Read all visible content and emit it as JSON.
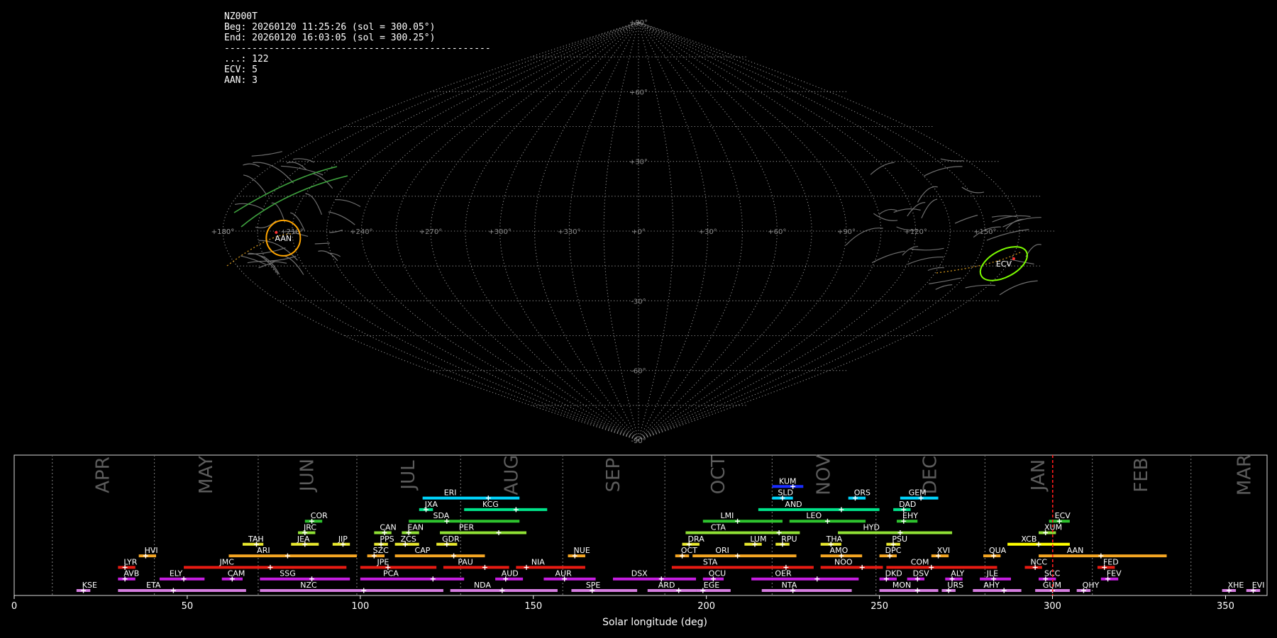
{
  "info": {
    "station": "NZ000T",
    "begin": "Beg: 20260120 11:25:26 (sol = 300.05°)",
    "end": "End: 20260120 16:03:05 (sol = 300.25°)",
    "separator": "------------------------------------------------",
    "counts": [
      "...: 122",
      "ECV: 5",
      "AAN: 3"
    ]
  },
  "sky": {
    "lon_ticks": [
      "+180°",
      "+150°",
      "+120°",
      "+90°",
      "+60°",
      "+30°",
      "+0°",
      "+330°",
      "+300°",
      "+270°",
      "+240°",
      "+210°",
      "+180°"
    ],
    "lat_ticks": [
      "+90°",
      "+60°",
      "+30°",
      "-30°",
      "-60°",
      "-90°"
    ],
    "radiants": [
      {
        "name": "AAN",
        "lon": 154,
        "lat": -3,
        "color": "#ffa500"
      },
      {
        "name": "ECV",
        "lon": 197,
        "lat": -14,
        "color": "#7cfc00"
      }
    ]
  },
  "chart_data": {
    "type": "gantt",
    "xlabel": "Solar longitude (deg)",
    "xlim": [
      0,
      362
    ],
    "xticks": [
      0,
      50,
      100,
      150,
      200,
      250,
      300,
      350
    ],
    "current_sol": 300.05,
    "months": [
      {
        "name": "APR",
        "start": 11.0
      },
      {
        "name": "MAY",
        "start": 40.5
      },
      {
        "name": "JUN",
        "start": 70.5
      },
      {
        "name": "JUL",
        "start": 99.0
      },
      {
        "name": "AUG",
        "start": 129.0
      },
      {
        "name": "SEP",
        "start": 158.5
      },
      {
        "name": "OCT",
        "start": 188.0
      },
      {
        "name": "NOV",
        "start": 219.0
      },
      {
        "name": "DEC",
        "start": 249.0
      },
      {
        "name": "JAN",
        "start": 280.5
      },
      {
        "name": "FEB",
        "start": 311.5
      },
      {
        "name": "MAR",
        "start": 340.0
      }
    ],
    "showers": [
      {
        "code": "KUM",
        "start": 219,
        "end": 228,
        "peak": 225,
        "row": 9,
        "color": "#1a2dff"
      },
      {
        "code": "ERI",
        "start": 118,
        "end": 146,
        "peak": 137,
        "row": 8,
        "color": "#00d7ff"
      },
      {
        "code": "SLD",
        "start": 219,
        "end": 225,
        "peak": 222,
        "row": 8,
        "color": "#00d7ff"
      },
      {
        "code": "ORS",
        "start": 241,
        "end": 246,
        "peak": 243,
        "row": 8,
        "color": "#00d7ff"
      },
      {
        "code": "GEM",
        "start": 256,
        "end": 267,
        "peak": 262,
        "row": 8,
        "color": "#00d7ff"
      },
      {
        "code": "JXA",
        "start": 117,
        "end": 121,
        "peak": 119,
        "row": 7,
        "color": "#00e38a"
      },
      {
        "code": "KCG",
        "start": 130,
        "end": 154,
        "peak": 145,
        "row": 7,
        "color": "#00e38a"
      },
      {
        "code": "AND",
        "start": 215,
        "end": 250,
        "peak": 239,
        "row": 7,
        "color": "#00e38a"
      },
      {
        "code": "DAD",
        "start": 254,
        "end": 259,
        "peak": 257,
        "row": 7,
        "color": "#00e38a"
      },
      {
        "code": "COR",
        "start": 84,
        "end": 89,
        "peak": 86,
        "row": 6,
        "color": "#2ec22e"
      },
      {
        "code": "SDA",
        "start": 114,
        "end": 146,
        "peak": 125,
        "row": 6,
        "color": "#2ec22e"
      },
      {
        "code": "LMI",
        "start": 199,
        "end": 222,
        "peak": 209,
        "row": 6,
        "color": "#2ec22e"
      },
      {
        "code": "LEO",
        "start": 224,
        "end": 246,
        "peak": 235,
        "row": 6,
        "color": "#2ec22e"
      },
      {
        "code": "EHY",
        "start": 255,
        "end": 261,
        "peak": 257,
        "row": 6,
        "color": "#2ec22e"
      },
      {
        "code": "ECV",
        "start": 299,
        "end": 305,
        "peak": 302,
        "row": 6,
        "color": "#2ec22e"
      },
      {
        "code": "JRC",
        "start": 82,
        "end": 87,
        "peak": 84,
        "row": 5,
        "color": "#8fe035"
      },
      {
        "code": "CAN",
        "start": 104,
        "end": 109,
        "peak": 107,
        "row": 5,
        "color": "#8fe035"
      },
      {
        "code": "EAN",
        "start": 112,
        "end": 117,
        "peak": 114,
        "row": 5,
        "color": "#8fe035"
      },
      {
        "code": "PER",
        "start": 123,
        "end": 148,
        "peak": 140,
        "row": 5,
        "color": "#8fe035"
      },
      {
        "code": "CTA",
        "start": 194,
        "end": 227,
        "peak": 221,
        "row": 5,
        "color": "#8fe035"
      },
      {
        "code": "HYD",
        "start": 238,
        "end": 271,
        "peak": 256,
        "row": 5,
        "color": "#8fe035"
      },
      {
        "code": "XUM",
        "start": 296,
        "end": 301,
        "peak": 298,
        "row": 5,
        "color": "#8fe035"
      },
      {
        "code": "TAH",
        "start": 66,
        "end": 72,
        "peak": 70,
        "row": 4,
        "color": "#e8e82e"
      },
      {
        "code": "JEA",
        "start": 80,
        "end": 88,
        "peak": 84,
        "row": 4,
        "color": "#e8e82e"
      },
      {
        "code": "JIP",
        "start": 92,
        "end": 97,
        "peak": 95,
        "row": 4,
        "color": "#e8e82e"
      },
      {
        "code": "PPS",
        "start": 104,
        "end": 108,
        "peak": 106,
        "row": 4,
        "color": "#e8e82e"
      },
      {
        "code": "ZCS",
        "start": 110,
        "end": 117,
        "peak": 113,
        "row": 4,
        "color": "#e8e82e"
      },
      {
        "code": "GDR",
        "start": 122,
        "end": 128,
        "peak": 125,
        "row": 4,
        "color": "#e8e82e"
      },
      {
        "code": "DRA",
        "start": 193,
        "end": 198,
        "peak": 195,
        "row": 4,
        "color": "#e8e82e"
      },
      {
        "code": "LUM",
        "start": 211,
        "end": 216,
        "peak": 214,
        "row": 4,
        "color": "#e8e82e"
      },
      {
        "code": "RPU",
        "start": 220,
        "end": 224,
        "peak": 222,
        "row": 4,
        "color": "#e8e82e"
      },
      {
        "code": "THA",
        "start": 233,
        "end": 239,
        "peak": 236,
        "row": 4,
        "color": "#e8e82e"
      },
      {
        "code": "PSU",
        "start": 252,
        "end": 256,
        "peak": 254,
        "row": 4,
        "color": "#e8e82e"
      },
      {
        "code": "XCB",
        "start": 287,
        "end": 305,
        "peak": 296,
        "row": 4,
        "color": "#ffff00"
      },
      {
        "code": "HVI",
        "start": 36,
        "end": 41,
        "peak": 38,
        "row": 3,
        "color": "#f5a623"
      },
      {
        "code": "ARI",
        "start": 62,
        "end": 99,
        "peak": 79,
        "row": 3,
        "color": "#f5a623"
      },
      {
        "code": "SZC",
        "start": 102,
        "end": 107,
        "peak": 104,
        "row": 3,
        "color": "#f5a623"
      },
      {
        "code": "CAP",
        "start": 110,
        "end": 136,
        "peak": 127,
        "row": 3,
        "color": "#f5a623"
      },
      {
        "code": "NUE",
        "start": 160,
        "end": 165,
        "peak": 162,
        "row": 3,
        "color": "#f5a623"
      },
      {
        "code": "OCT",
        "start": 191,
        "end": 195,
        "peak": 193,
        "row": 3,
        "color": "#f5a623"
      },
      {
        "code": "ORI",
        "start": 196,
        "end": 226,
        "peak": 209,
        "row": 3,
        "color": "#f5a623"
      },
      {
        "code": "AMO",
        "start": 233,
        "end": 245,
        "peak": 239,
        "row": 3,
        "color": "#f5a623"
      },
      {
        "code": "DPC",
        "start": 250,
        "end": 255,
        "peak": 253,
        "row": 3,
        "color": "#f5a623"
      },
      {
        "code": "XVI",
        "start": 265,
        "end": 270,
        "peak": 267,
        "row": 3,
        "color": "#f5a623"
      },
      {
        "code": "QUA",
        "start": 280,
        "end": 285,
        "peak": 283,
        "row": 3,
        "color": "#f5a623"
      },
      {
        "code": "AAN",
        "start": 296,
        "end": 333,
        "peak": 314,
        "row": 3,
        "color": "#f5a623"
      },
      {
        "code": "LYR",
        "start": 30,
        "end": 35,
        "peak": 32,
        "row": 2,
        "color": "#e81b12"
      },
      {
        "code": "JMC",
        "start": 49,
        "end": 96,
        "peak": 74,
        "row": 2,
        "color": "#e81b12"
      },
      {
        "code": "JPE",
        "start": 100,
        "end": 122,
        "peak": 108,
        "row": 2,
        "color": "#e81b12"
      },
      {
        "code": "PAU",
        "start": 124,
        "end": 143,
        "peak": 136,
        "row": 2,
        "color": "#e81b12"
      },
      {
        "code": "NIA",
        "start": 145,
        "end": 165,
        "peak": 148,
        "row": 2,
        "color": "#e81b12"
      },
      {
        "code": "STA",
        "start": 190,
        "end": 231,
        "peak": 223,
        "row": 2,
        "color": "#e81b12"
      },
      {
        "code": "NOO",
        "start": 233,
        "end": 251,
        "peak": 245,
        "row": 2,
        "color": "#e81b12"
      },
      {
        "code": "COM",
        "start": 252,
        "end": 284,
        "peak": 265,
        "row": 2,
        "color": "#e81b12"
      },
      {
        "code": "NCC",
        "start": 292,
        "end": 297,
        "peak": 295,
        "row": 2,
        "color": "#e81b12"
      },
      {
        "code": "FED",
        "start": 313,
        "end": 318,
        "peak": 315,
        "row": 2,
        "color": "#e81b12"
      },
      {
        "code": "AVB",
        "start": 30,
        "end": 35,
        "peak": 32,
        "row": 1,
        "color": "#c61ee0"
      },
      {
        "code": "ELY",
        "start": 42,
        "end": 55,
        "peak": 49,
        "row": 1,
        "color": "#c61ee0"
      },
      {
        "code": "CAM",
        "start": 60,
        "end": 66,
        "peak": 63,
        "row": 1,
        "color": "#c61ee0"
      },
      {
        "code": "SSG",
        "start": 71,
        "end": 97,
        "peak": 86,
        "row": 1,
        "color": "#c61ee0"
      },
      {
        "code": "PCA",
        "start": 100,
        "end": 130,
        "peak": 121,
        "row": 1,
        "color": "#c61ee0"
      },
      {
        "code": "AUD",
        "start": 139,
        "end": 147,
        "peak": 142,
        "row": 1,
        "color": "#c61ee0"
      },
      {
        "code": "AUR",
        "start": 153,
        "end": 168,
        "peak": 159,
        "row": 1,
        "color": "#c61ee0"
      },
      {
        "code": "DSX",
        "start": 173,
        "end": 197,
        "peak": 187,
        "row": 1,
        "color": "#c61ee0"
      },
      {
        "code": "OCU",
        "start": 199,
        "end": 205,
        "peak": 202,
        "row": 1,
        "color": "#c61ee0"
      },
      {
        "code": "OER",
        "start": 213,
        "end": 244,
        "peak": 232,
        "row": 1,
        "color": "#c61ee0"
      },
      {
        "code": "DKD",
        "start": 250,
        "end": 255,
        "peak": 252,
        "row": 1,
        "color": "#c61ee0"
      },
      {
        "code": "DSV",
        "start": 258,
        "end": 263,
        "peak": 261,
        "row": 1,
        "color": "#c61ee0"
      },
      {
        "code": "ALY",
        "start": 269,
        "end": 274,
        "peak": 271,
        "row": 1,
        "color": "#c61ee0"
      },
      {
        "code": "JLE",
        "start": 279,
        "end": 288,
        "peak": 283,
        "row": 1,
        "color": "#c61ee0"
      },
      {
        "code": "SCC",
        "start": 296,
        "end": 301,
        "peak": 298,
        "row": 1,
        "color": "#c61ee0"
      },
      {
        "code": "FEV",
        "start": 314,
        "end": 319,
        "peak": 316,
        "row": 1,
        "color": "#c61ee0"
      },
      {
        "code": "KSE",
        "start": 18,
        "end": 22,
        "peak": 20,
        "row": 0,
        "color": "#d67ee0"
      },
      {
        "code": "ETA",
        "start": 30,
        "end": 67,
        "peak": 46,
        "row": 0,
        "color": "#d67ee0"
      },
      {
        "code": "NZC",
        "start": 71,
        "end": 124,
        "peak": 101,
        "row": 0,
        "color": "#d67ee0"
      },
      {
        "code": "NDA",
        "start": 126,
        "end": 157,
        "peak": 141,
        "row": 0,
        "color": "#d67ee0"
      },
      {
        "code": "SPE",
        "start": 161,
        "end": 180,
        "peak": 167,
        "row": 0,
        "color": "#d67ee0"
      },
      {
        "code": "ARD",
        "start": 183,
        "end": 197,
        "peak": 192,
        "row": 0,
        "color": "#d67ee0"
      },
      {
        "code": "EGE",
        "start": 197,
        "end": 207,
        "peak": 199,
        "row": 0,
        "color": "#d67ee0"
      },
      {
        "code": "NTA",
        "start": 216,
        "end": 242,
        "peak": 225,
        "row": 0,
        "color": "#d67ee0"
      },
      {
        "code": "MON",
        "start": 250,
        "end": 267,
        "peak": 261,
        "row": 0,
        "color": "#d67ee0"
      },
      {
        "code": "URS",
        "start": 268,
        "end": 272,
        "peak": 270,
        "row": 0,
        "color": "#d67ee0"
      },
      {
        "code": "AHY",
        "start": 277,
        "end": 291,
        "peak": 286,
        "row": 0,
        "color": "#d67ee0"
      },
      {
        "code": "GUM",
        "start": 295,
        "end": 305,
        "peak": 300,
        "row": 0,
        "color": "#d67ee0"
      },
      {
        "code": "QHY",
        "start": 307,
        "end": 311,
        "peak": 309,
        "row": 0,
        "color": "#d67ee0"
      },
      {
        "code": "XHE",
        "start": 349,
        "end": 353,
        "peak": 351,
        "row": 0,
        "color": "#d67ee0"
      },
      {
        "code": "EVI",
        "start": 356,
        "end": 360,
        "peak": 358,
        "row": 0,
        "color": "#d67ee0"
      }
    ]
  }
}
